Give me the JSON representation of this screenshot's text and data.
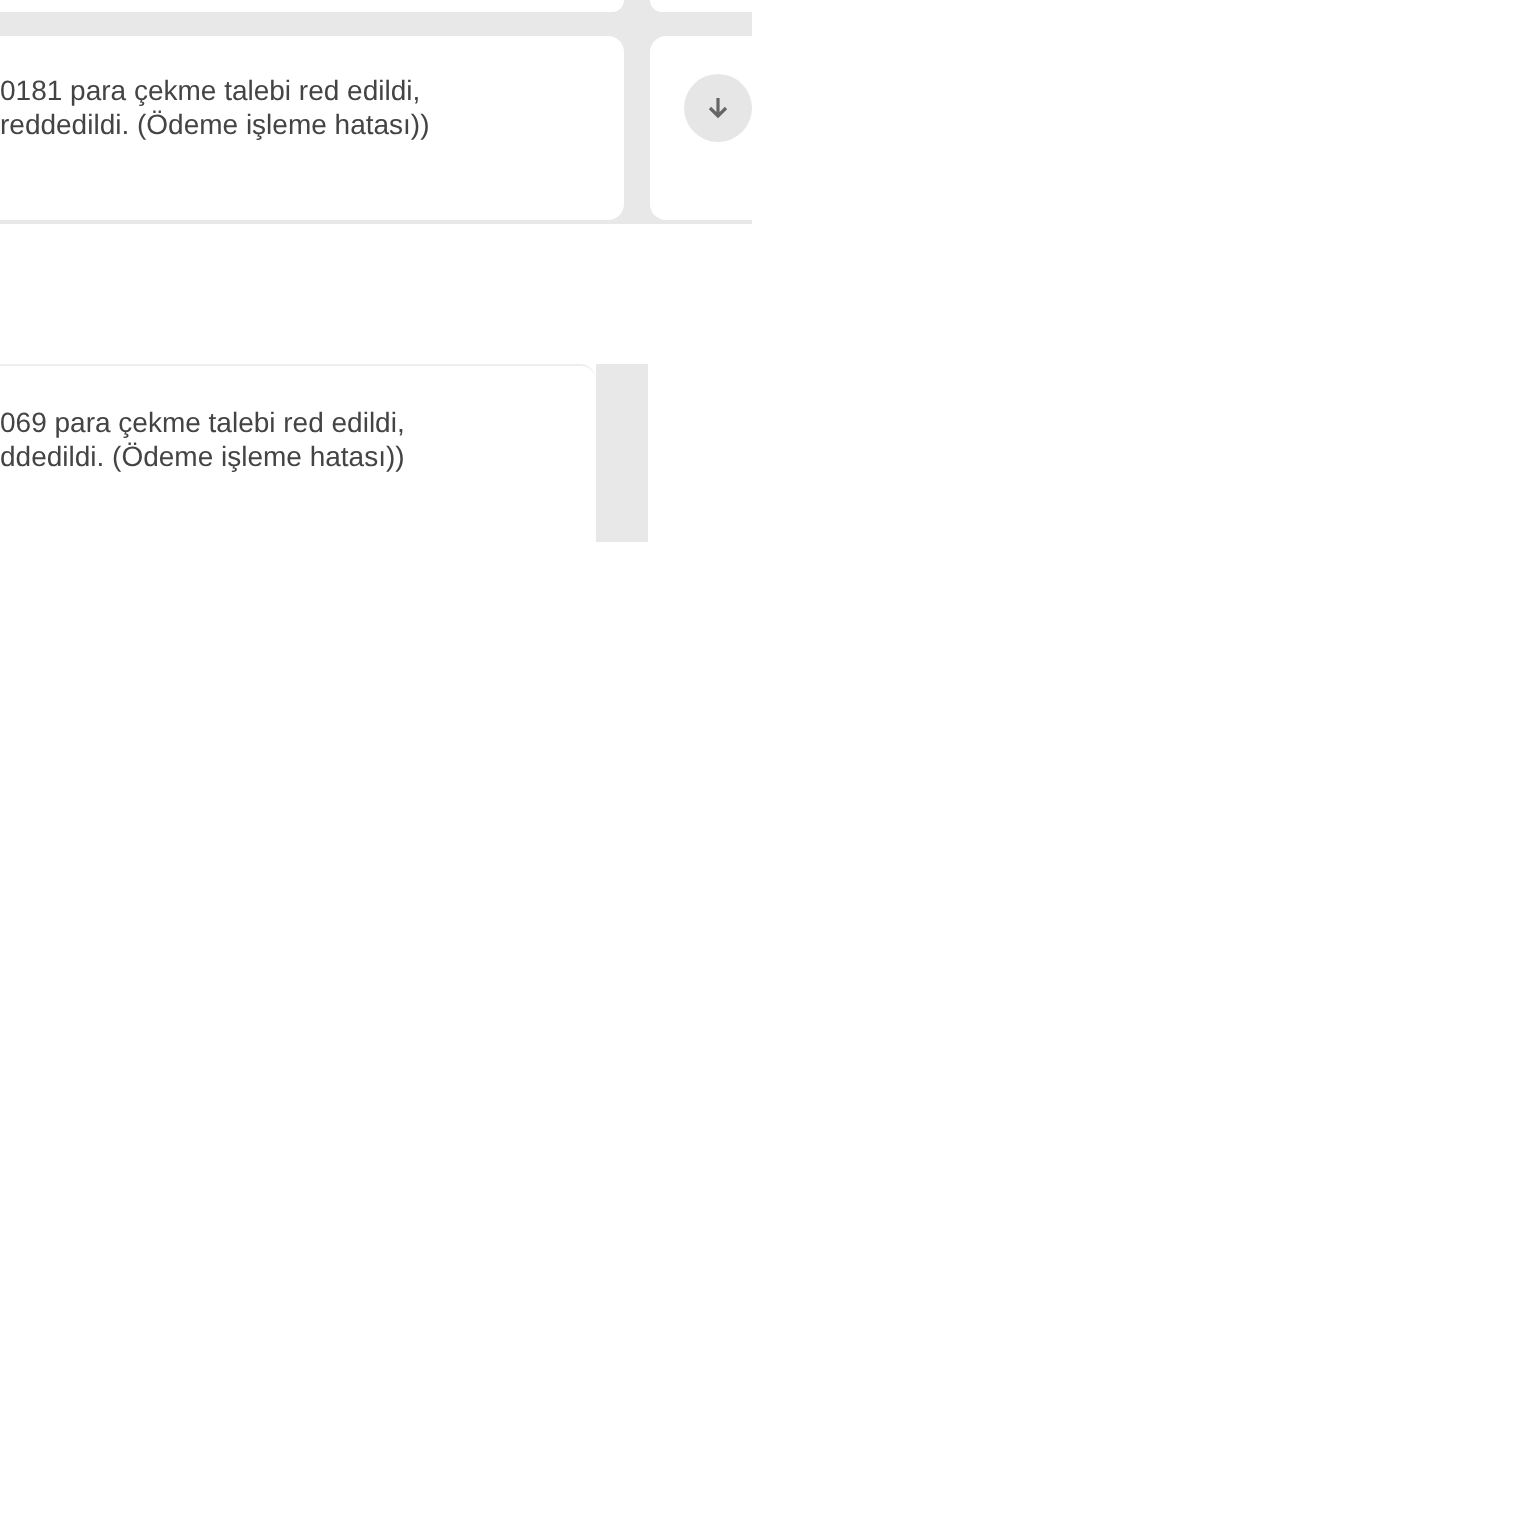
{
  "messages": [
    {
      "lines": [
        "0181 para çekme talebi red edildi,",
        "reddedildi. (Ödeme işleme hatası))"
      ],
      "has_action": true
    },
    {
      "lines": [
        "069 para çekme talebi red edildi,",
        "ddedildi. (Ödeme işleme hatası))"
      ],
      "has_action": false
    }
  ]
}
